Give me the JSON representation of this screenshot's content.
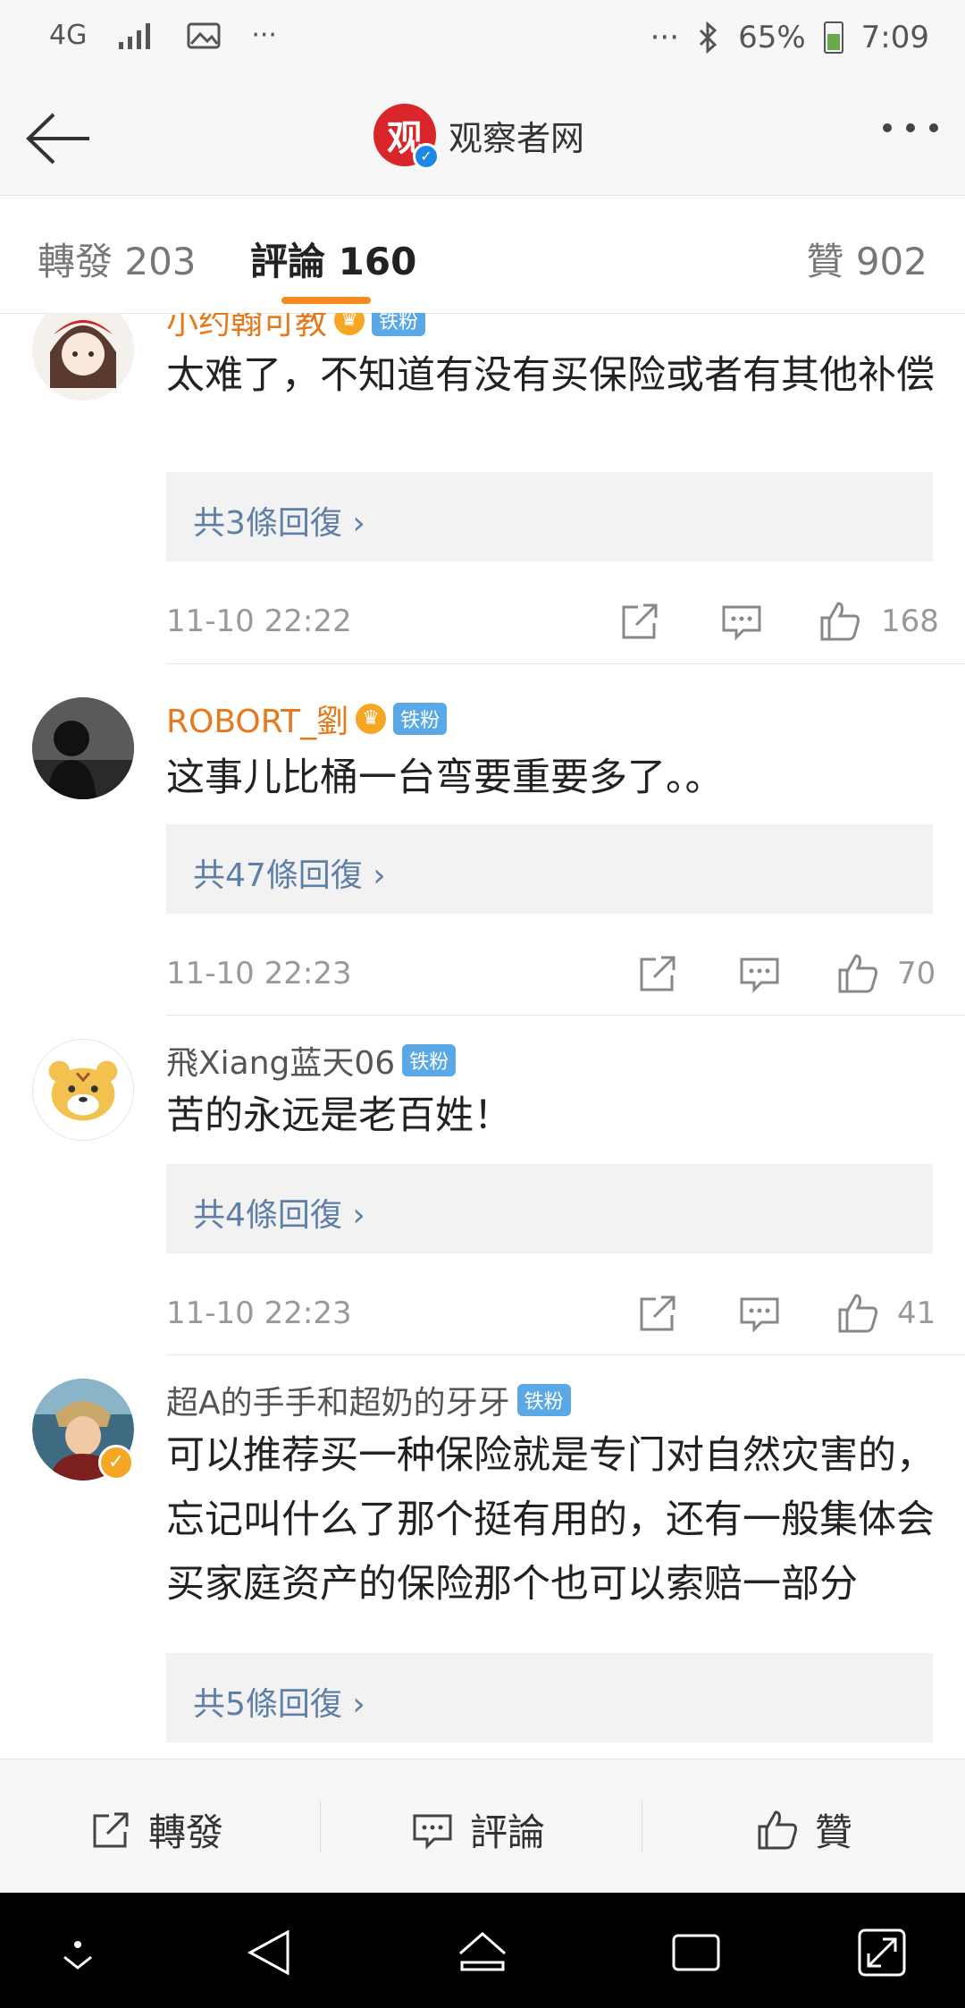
{
  "status_bar": {
    "network": "4G",
    "battery": "65%",
    "time": "7:09"
  },
  "header": {
    "title": "观察者网",
    "logo_char": "观"
  },
  "tabs": [
    {
      "label": "轉發 203"
    },
    {
      "label": "評論 160"
    },
    {
      "label": "贊 902"
    }
  ],
  "comments": [
    {
      "name": "小约翰可教",
      "badge": "铁粉",
      "text": "太难了，不知道有没有买保险或者有其他补偿",
      "replies": "共3條回復 ›",
      "time": "11-10 22:22",
      "likes": "168"
    },
    {
      "name": "ROBORT_劉",
      "badge": "铁粉",
      "text": "这事儿比桶一台弯要重要多了。。",
      "replies": "共47條回復 ›",
      "time": "11-10 22:23",
      "likes": "70"
    },
    {
      "name": "飛Xiang蓝天06",
      "badge": "铁粉",
      "text": "苦的永远是老百姓！",
      "replies": "共4條回復 ›",
      "time": "11-10 22:23",
      "likes": "41"
    },
    {
      "name": "超A的手手和超奶的牙牙",
      "badge": "铁粉",
      "text": "可以推荐买一种保险就是专门对自然灾害的，忘记叫什么了那个挺有用的，还有一般集体会买家庭资产的保险那个也可以索赔一部分",
      "replies": "共5條回復 ›"
    }
  ],
  "bottom_bar": {
    "repost": "轉發",
    "comment": "評論",
    "like": "贊"
  }
}
